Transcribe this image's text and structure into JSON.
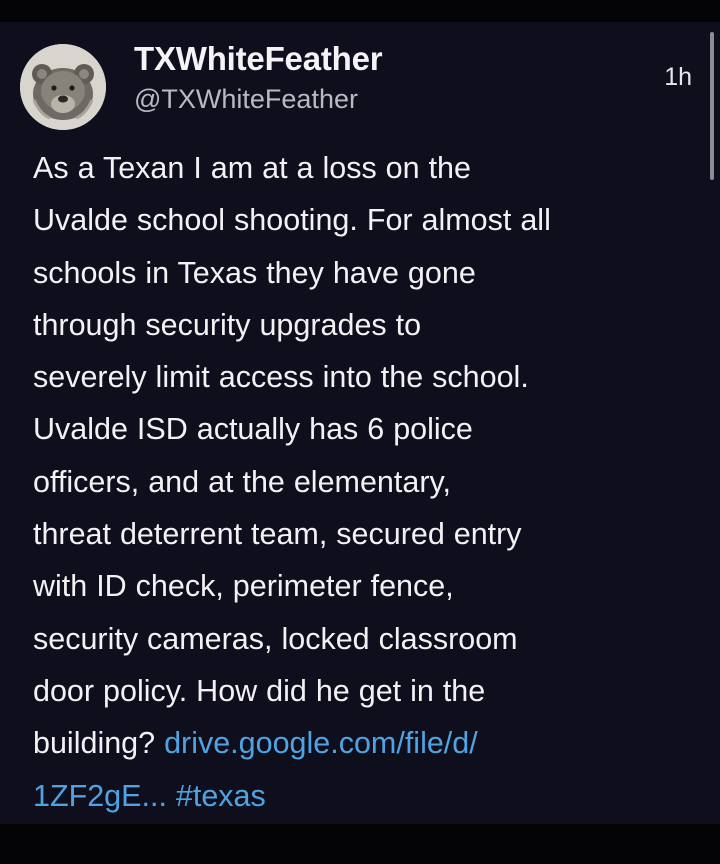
{
  "post": {
    "author": {
      "display_name": "TXWhiteFeather",
      "handle": "@TXWhiteFeather",
      "avatar_icon": "bear-avatar-icon"
    },
    "timestamp": "1h",
    "body_lines": [
      "As a Texan I am at a loss on the",
      "Uvalde school shooting. For almost all",
      "schools in Texas they have gone",
      "through security upgrades to",
      "severely limit access into the school.",
      "Uvalde ISD actually has 6 police",
      "officers, and at the elementary,",
      "threat deterrent team, secured entry",
      "with ID check, perimeter fence,",
      "security cameras, locked classroom",
      "door policy. How did he get in the"
    ],
    "body_last_prefix": "building? ",
    "link_text_line1": "drive.google.com/file/d/",
    "link_text_line2": "1ZF2gE...",
    "hashtag": "#texas"
  },
  "colors": {
    "background": "#0f0e1d",
    "text": "#f2f2f4",
    "secondary_text": "#b9b9c3",
    "link": "#4fa3e3"
  }
}
